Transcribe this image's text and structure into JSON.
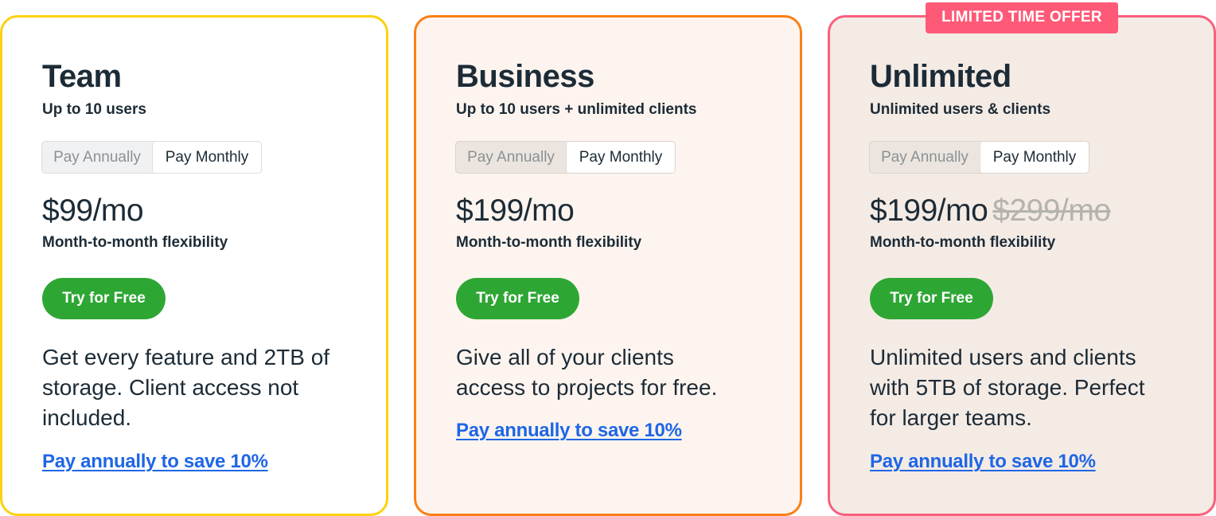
{
  "plans": [
    {
      "name": "Team",
      "subtitle": "Up to 10 users",
      "toggle": {
        "annual_label": "Pay Annually",
        "monthly_label": "Pay Monthly",
        "selected": "monthly"
      },
      "price": "$99/mo",
      "old_price": "",
      "price_note": "Month-to-month flexibility",
      "cta_label": "Try for Free",
      "description": "Get every feature and 2TB of storage. Client access not included.",
      "save_link": "Pay annually to save 10%",
      "accent_color": "#fdd10f",
      "background_color": "#ffffff"
    },
    {
      "name": "Business",
      "subtitle": "Up to 10 users + unlimited clients",
      "toggle": {
        "annual_label": "Pay Annually",
        "monthly_label": "Pay Monthly",
        "selected": "monthly"
      },
      "price": "$199/mo",
      "old_price": "",
      "price_note": "Month-to-month flexibility",
      "cta_label": "Try for Free",
      "description": "Give all of your clients access to projects for free.",
      "save_link": "Pay annually to save 10%",
      "accent_color": "#fa7f17",
      "background_color": "#fdf4ef"
    },
    {
      "name": "Unlimited",
      "subtitle": "Unlimited users & clients",
      "badge": "LIMITED TIME OFFER",
      "toggle": {
        "annual_label": "Pay Annually",
        "monthly_label": "Pay Monthly",
        "selected": "monthly"
      },
      "price": "$199/mo",
      "old_price": "$299/mo",
      "price_note": "Month-to-month flexibility",
      "cta_label": "Try for Free",
      "description": "Unlimited users and clients with 5TB of storage. Perfect for larger teams.",
      "save_link": "Pay annually to save 10%",
      "accent_color": "#f8607e",
      "background_color": "#f4ebe5"
    }
  ],
  "colors": {
    "cta_green": "#2ea634",
    "link_blue": "#1f66e5",
    "text_dark": "#1c2b36",
    "badge_pink": "#fe5a78",
    "strike_gray": "#b5b3ae"
  }
}
